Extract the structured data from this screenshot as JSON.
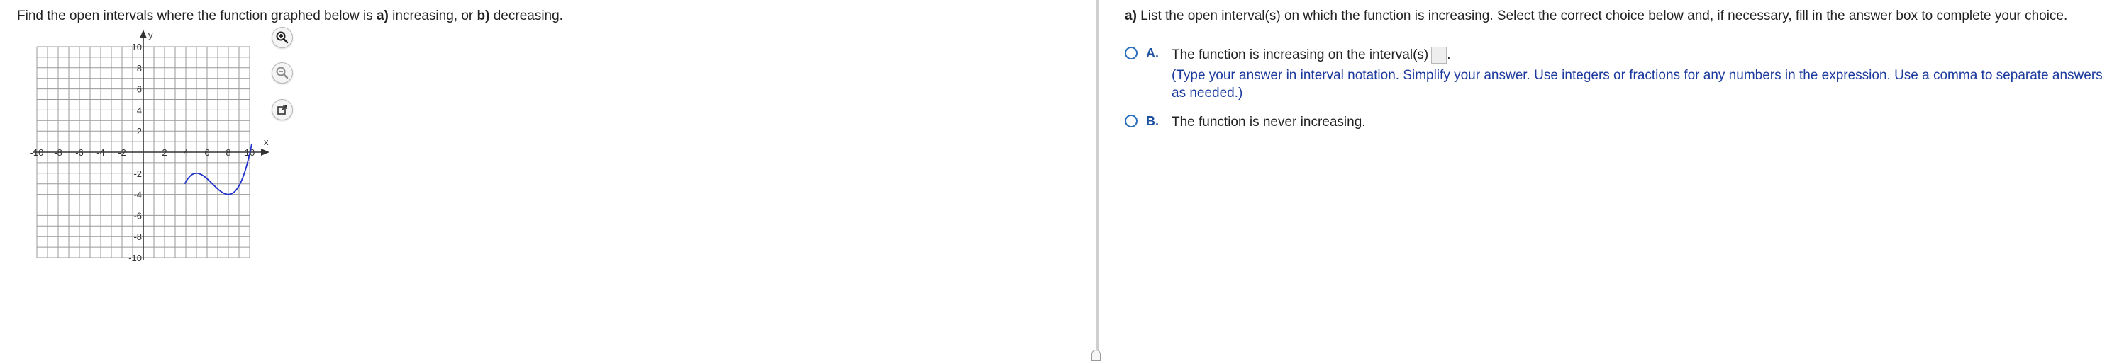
{
  "question": {
    "prompt_prefix": "Find the open intervals where the function graphed below is ",
    "prompt_a_label": "a)",
    "prompt_mid": " increasing, or ",
    "prompt_b_label": "b)",
    "prompt_suffix": " decreasing."
  },
  "graph": {
    "x_axis_label": "x",
    "y_axis_label": "y",
    "x_tick_labels": [
      "-10",
      "-8",
      "-6",
      "-4",
      "-2",
      "2",
      "4",
      "6",
      "8",
      "10"
    ],
    "y_tick_labels": [
      "10",
      "8",
      "6",
      "4",
      "2",
      "-2",
      "-4",
      "-6",
      "-8",
      "-10"
    ],
    "xlim": [
      -10,
      10
    ],
    "ylim": [
      -10,
      10
    ],
    "curve_color": "#2233cc",
    "grid_color": "#9a9a9a"
  },
  "tools": [
    {
      "name": "zoom-in-icon"
    },
    {
      "name": "zoom-out-icon"
    },
    {
      "name": "external-link-icon"
    }
  ],
  "part_a": {
    "label": "a)",
    "instruction": " List the open interval(s) on which the function is increasing. Select the correct choice below and, if necessary, fill in the answer box to complete your choice.",
    "choice_a": {
      "letter": "A.",
      "text": "The function is increasing on the interval(s)",
      "after_box": ".",
      "hint": "(Type your answer in interval notation. Simplify your answer. Use integers or fractions for any numbers in the expression. Use a comma to separate answers as needed.)"
    },
    "choice_b": {
      "letter": "B.",
      "text": "The function is never increasing."
    }
  },
  "colors": {
    "accent": "#2a6ebd",
    "hint_text": "#1c3a9e"
  }
}
